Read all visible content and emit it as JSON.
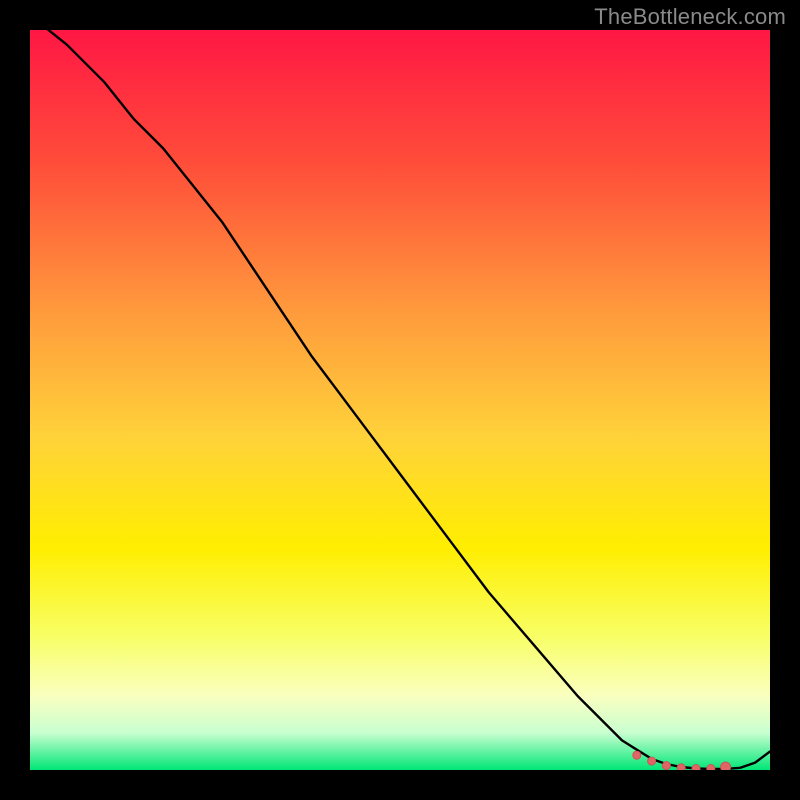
{
  "attribution": "TheBottleneck.com",
  "colors": {
    "background": "#000000",
    "gradient_top": "#ff1744",
    "gradient_mid_top": "#ff8a3d",
    "gradient_mid": "#ffee00",
    "gradient_low": "#f6ffb0",
    "gradient_bottom": "#00e676",
    "curve": "#000000",
    "marker_fill": "#e06666",
    "marker_stroke": "#cc5555",
    "attribution_text": "#8a8a8a"
  },
  "chart_data": {
    "type": "line",
    "title": "",
    "xlabel": "",
    "ylabel": "",
    "xlim": [
      0,
      100
    ],
    "ylim": [
      0,
      100
    ],
    "grid": false,
    "series": [
      {
        "name": "curve",
        "x": [
          0,
          5,
          10,
          14,
          18,
          22,
          26,
          30,
          34,
          38,
          44,
          50,
          56,
          62,
          68,
          74,
          80,
          84,
          86,
          88,
          90,
          92,
          94,
          96,
          98,
          100
        ],
        "y": [
          102,
          98,
          93,
          88,
          84,
          79,
          74,
          68,
          62,
          56,
          48,
          40,
          32,
          24,
          17,
          10,
          4,
          1.5,
          0.8,
          0.4,
          0.2,
          0.15,
          0.15,
          0.3,
          1.0,
          2.5
        ]
      }
    ],
    "markers": [
      {
        "x": 82,
        "y": 2.0
      },
      {
        "x": 84,
        "y": 1.2
      },
      {
        "x": 86,
        "y": 0.6
      },
      {
        "x": 88,
        "y": 0.3
      },
      {
        "x": 90,
        "y": 0.2
      },
      {
        "x": 92,
        "y": 0.2
      },
      {
        "x": 94,
        "y": 0.4
      }
    ]
  }
}
